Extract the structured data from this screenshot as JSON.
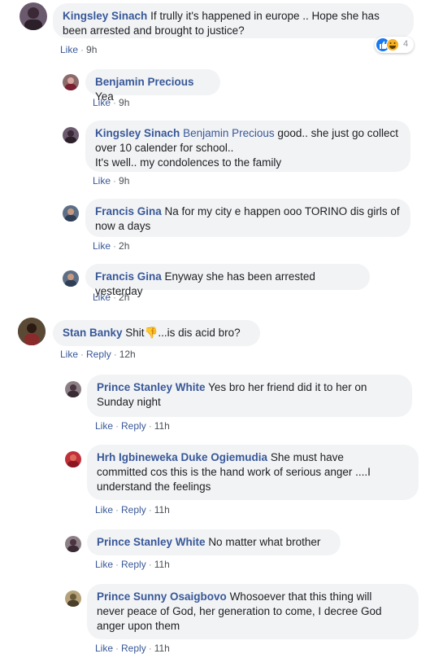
{
  "comments": [
    {
      "name": "Kingsley Sinach",
      "text": "If trully it's happened in europe .. Hope she has been arrested and brought to justice?",
      "actions": {
        "like": "Like",
        "time": "9h"
      },
      "reactions": {
        "icons": [
          "like-icon",
          "haha-icon"
        ],
        "count": "4"
      }
    },
    {
      "name": "Benjamin Precious",
      "text": "Yea",
      "actions": {
        "like": "Like",
        "time": "9h"
      }
    },
    {
      "name": "Kingsley Sinach",
      "mention": "Benjamin Precious",
      "text_line1": "good.. she just go collect",
      "text_line2": "over 10 calender for school..",
      "text_line3": "It's well.. my condolences to the family",
      "actions": {
        "like": "Like",
        "time": "9h"
      }
    },
    {
      "name": "Francis Gina",
      "text_line1": "Na for my city e happen ooo TORINO dis girls of",
      "text_line2": "now a days",
      "actions": {
        "like": "Like",
        "time": "2h"
      }
    },
    {
      "name": "Francis Gina",
      "text": "Enyway she has been arrested yesterday",
      "actions": {
        "like": "Like",
        "time": "2h"
      }
    },
    {
      "name": "Stan Banky",
      "text_before": "Shit",
      "emoji": "👎",
      "text_after": "...is dis acid bro?",
      "actions": {
        "like": "Like",
        "reply": "Reply",
        "time": "12h"
      }
    },
    {
      "name": "Prince Stanley White",
      "text_line1": "Yes bro her friend did it to her on",
      "text_line2": "Sunday night",
      "actions": {
        "like": "Like",
        "reply": "Reply",
        "time": "11h"
      }
    },
    {
      "name": "Hrh Igbineweka Duke Ogiemudia",
      "text_line1": "She must have",
      "text_line2": "committed cos this is the hand work of serious anger ....I",
      "text_line3": "understand the feelings",
      "actions": {
        "like": "Like",
        "reply": "Reply",
        "time": "11h"
      }
    },
    {
      "name": "Prince Stanley White",
      "text": "No matter what brother",
      "actions": {
        "like": "Like",
        "reply": "Reply",
        "time": "11h"
      }
    },
    {
      "name": "Prince Sunny Osaigbovo",
      "text_line1": "Whosoever that this thing will",
      "text_line2": "never peace of God, her generation to come, I decree God",
      "text_line3": "anger upon them",
      "actions": {
        "like": "Like",
        "reply": "Reply",
        "time": "11h"
      }
    }
  ],
  "colors": {
    "link": "#385898",
    "bubble": "#f2f3f5",
    "meta": "#4b4f56"
  }
}
